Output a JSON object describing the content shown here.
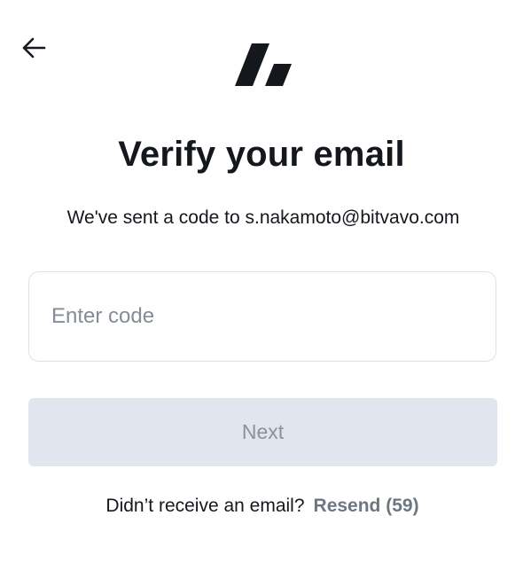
{
  "header": {
    "back_icon": "arrow-left-icon",
    "logo_icon": "bitvavo-logo-icon"
  },
  "main": {
    "title": "Verify your email",
    "subtitle_prefix": "We've sent a code to ",
    "email": "s.nakamoto@bitvavo.com",
    "code_input": {
      "value": "",
      "placeholder": "Enter code"
    },
    "next_label": "Next",
    "resend_prompt": "Didn’t receive an email?",
    "resend_label": "Resend (59)"
  },
  "colors": {
    "text": "#14171c",
    "placeholder": "#858c96",
    "input_border": "#dde0e5",
    "button_disabled_bg": "#e1e6ee",
    "button_disabled_text": "#8b929b",
    "resend_link": "#6d7683"
  }
}
